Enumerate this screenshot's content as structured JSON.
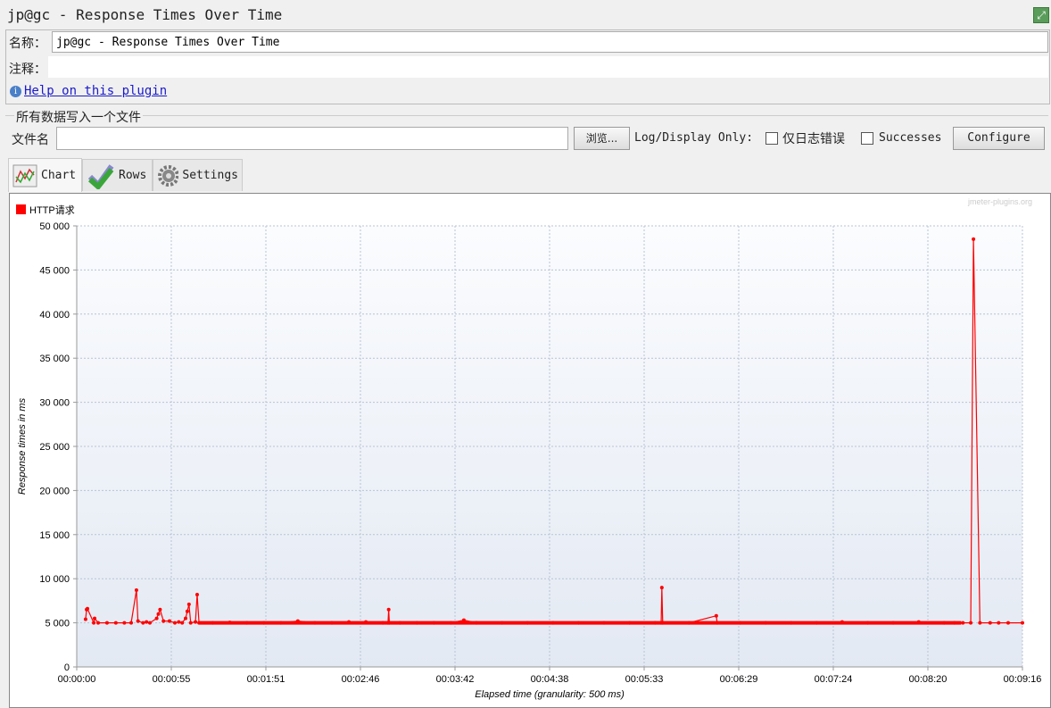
{
  "window": {
    "title": "jp@gc - Response Times Over Time"
  },
  "name_field": {
    "label": "名称：",
    "value": "jp@gc - Response Times Over Time"
  },
  "comment_field": {
    "label": "注释：",
    "value": ""
  },
  "help_link": "Help on this plugin",
  "file_section": {
    "title": "所有数据写入一个文件",
    "filename_label": "文件名",
    "filename_value": "",
    "browse_label": "浏览...",
    "log_display_label": "Log/Display Only:",
    "errors_only_label": "仅日志错误",
    "errors_only_checked": false,
    "successes_label": "Successes",
    "successes_checked": false,
    "configure_label": "Configure"
  },
  "tabs": [
    {
      "label": "Chart",
      "selected": true
    },
    {
      "label": "Rows"
    },
    {
      "label": "Settings"
    }
  ],
  "watermark": "jmeter-plugins.org",
  "chart_data": {
    "type": "line",
    "legend": [
      {
        "name": "HTTP请求",
        "color": "#ff0000"
      }
    ],
    "legend_placement": "top-left",
    "ylabel": "Response times in ms",
    "xlabel": "Elapsed time (granularity: 500 ms)",
    "ylim": [
      0,
      50000
    ],
    "yticks": [
      0,
      5000,
      10000,
      15000,
      20000,
      25000,
      30000,
      35000,
      40000,
      45000,
      50000
    ],
    "ytick_labels": [
      "0",
      "5 000",
      "10 000",
      "15 000",
      "20 000",
      "25 000",
      "30 000",
      "35 000",
      "40 000",
      "45 000",
      "50 000"
    ],
    "xlim_seconds": [
      0,
      556
    ],
    "xtick_labels": [
      "00:00:00",
      "00:00:55",
      "00:01:51",
      "00:02:46",
      "00:03:42",
      "00:04:38",
      "00:05:33",
      "00:06:29",
      "00:07:24",
      "00:08:20",
      "00:09:16"
    ],
    "grid": true,
    "series": [
      {
        "name": "HTTP请求",
        "points": [
          [
            5.2,
            5400
          ],
          [
            5.8,
            6500
          ],
          [
            6.3,
            6600
          ],
          [
            10,
            5000
          ],
          [
            10.5,
            5500
          ],
          [
            12.6,
            5000
          ],
          [
            17.8,
            5000
          ],
          [
            23,
            5000
          ],
          [
            28,
            5000
          ],
          [
            32,
            5000
          ],
          [
            35.1,
            8700
          ],
          [
            36,
            5200
          ],
          [
            39,
            5000
          ],
          [
            41,
            5100
          ],
          [
            43,
            5000
          ],
          [
            47,
            5500
          ],
          [
            48,
            6000
          ],
          [
            49,
            6500
          ],
          [
            51,
            5200
          ],
          [
            54.5,
            5200
          ],
          [
            57.7,
            5000
          ],
          [
            60,
            5100
          ],
          [
            62,
            5000
          ],
          [
            64,
            5500
          ],
          [
            65,
            6300
          ],
          [
            66,
            7100
          ],
          [
            67,
            5000
          ],
          [
            69.8,
            5100
          ],
          [
            70.8,
            8200
          ],
          [
            71.9,
            5000
          ],
          [
            80,
            5000
          ],
          [
            90,
            5050
          ],
          [
            100,
            5000
          ],
          [
            110,
            5000
          ],
          [
            120,
            5000
          ],
          [
            130,
            5200
          ],
          [
            140,
            5000
          ],
          [
            150,
            5000
          ],
          [
            160,
            5100
          ],
          [
            170,
            5100
          ],
          [
            180,
            5000
          ],
          [
            183,
            5000
          ],
          [
            183.4,
            6500
          ],
          [
            183.8,
            5000
          ],
          [
            190,
            5000
          ],
          [
            200,
            5000
          ],
          [
            210,
            5000
          ],
          [
            220,
            5000
          ],
          [
            227.6,
            5300
          ],
          [
            235,
            5000
          ],
          [
            250,
            5000
          ],
          [
            265,
            5000
          ],
          [
            280,
            5000
          ],
          [
            295,
            5000
          ],
          [
            310,
            5000
          ],
          [
            325,
            5000
          ],
          [
            340,
            5000
          ],
          [
            343.6,
            5000
          ],
          [
            344,
            9000
          ],
          [
            344.5,
            5000
          ],
          [
            360,
            5000
          ],
          [
            376,
            5800
          ],
          [
            376.5,
            5000
          ],
          [
            390,
            5000
          ],
          [
            405,
            5000
          ],
          [
            420,
            5000
          ],
          [
            435,
            5000
          ],
          [
            450,
            5100
          ],
          [
            465,
            5000
          ],
          [
            480,
            5000
          ],
          [
            495,
            5100
          ],
          [
            510,
            5000
          ],
          [
            516,
            5000
          ],
          [
            521,
            5000
          ],
          [
            525.6,
            5000
          ],
          [
            527.2,
            48500
          ],
          [
            531,
            5000
          ],
          [
            537,
            5000
          ],
          [
            542,
            5000
          ],
          [
            547.6,
            5000
          ],
          [
            556,
            5000
          ]
        ]
      }
    ]
  }
}
